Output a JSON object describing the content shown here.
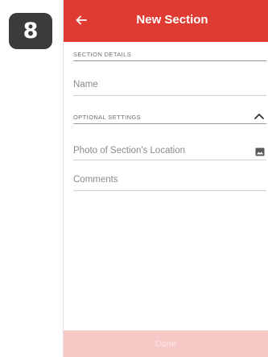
{
  "step": {
    "number": "8"
  },
  "app_bar": {
    "title": "New Section",
    "back_icon": "arrow-left-icon",
    "color": "#e03b32"
  },
  "sections": {
    "details_header": "SECTION DETAILS",
    "optional_header": "OPTIONAL SETTINGS",
    "optional_icon": "chevron-up-icon"
  },
  "fields": {
    "name_placeholder": "Name",
    "photo_placeholder": "Photo of Section's Location",
    "photo_icon": "image-icon",
    "comments_placeholder": "Comments"
  },
  "footer": {
    "done_label": "Done",
    "color": "#f6c8c6"
  }
}
